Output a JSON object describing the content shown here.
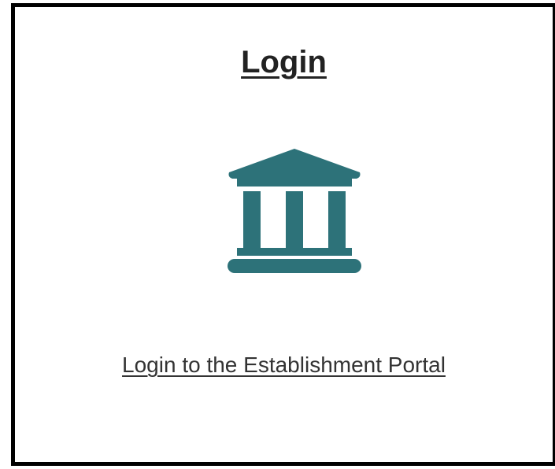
{
  "card": {
    "title": "Login",
    "icon": "bank-building-icon",
    "link_label": "Login to the Establishment Portal"
  },
  "colors": {
    "icon": "#2d7279",
    "border": "#000000",
    "text": "#222222"
  }
}
